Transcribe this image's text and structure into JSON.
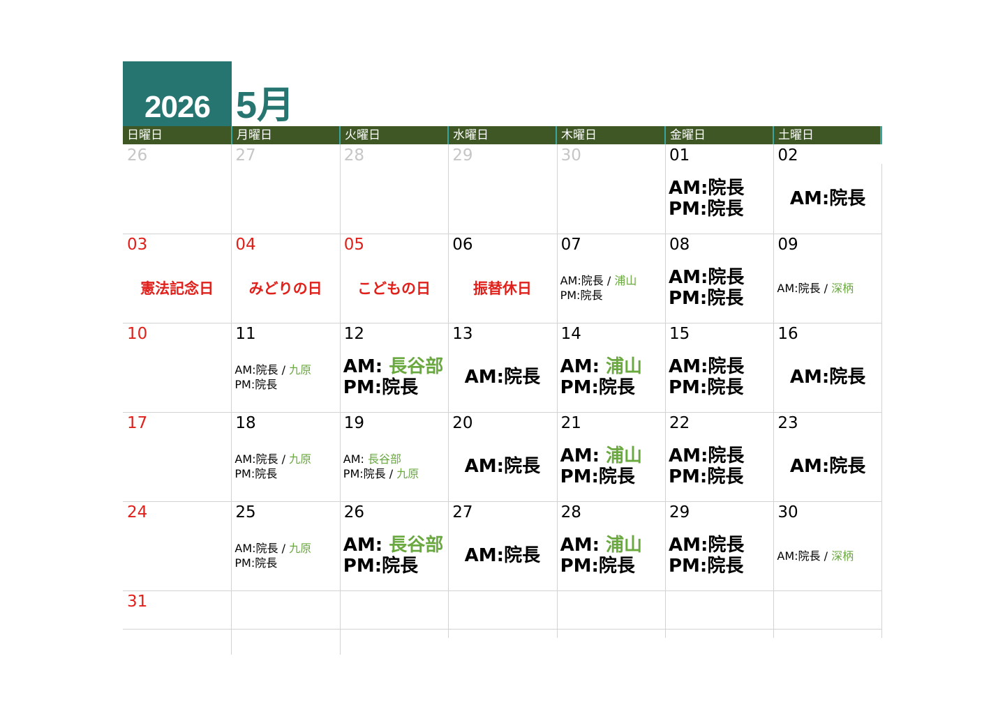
{
  "year": "2026",
  "month": "5月",
  "weekdays": [
    "日曜日",
    "月曜日",
    "火曜日",
    "水曜日",
    "木曜日",
    "金曜日",
    "土曜日"
  ],
  "colors": {
    "teal": "#277570",
    "header_green": "#3f5725",
    "holiday_red": "#e0201b",
    "doctor_green": "#6aa840",
    "muted": "#c6c6c6"
  },
  "weeks": [
    [
      {
        "day": "26",
        "type": "muted"
      },
      {
        "day": "27",
        "type": "muted"
      },
      {
        "day": "28",
        "type": "muted"
      },
      {
        "day": "29",
        "type": "muted"
      },
      {
        "day": "30",
        "type": "muted"
      },
      {
        "day": "01",
        "style": "big",
        "lines": [
          {
            "label": "AM:",
            "name": "院長"
          },
          {
            "label": "PM:",
            "name": "院長"
          }
        ]
      },
      {
        "day": "02",
        "style": "big",
        "align": "center",
        "lines": [
          {
            "label": "AM:",
            "name": "院長"
          }
        ]
      }
    ],
    [
      {
        "day": "03",
        "type": "holiday",
        "holiday": "憲法記念日"
      },
      {
        "day": "04",
        "type": "holiday",
        "holiday": "みどりの日"
      },
      {
        "day": "05",
        "type": "holiday",
        "holiday": "こどもの日"
      },
      {
        "day": "06",
        "holiday": "振替休日"
      },
      {
        "day": "07",
        "style": "small",
        "lines": [
          {
            "label": "AM:",
            "name": "院長",
            "extra": "浦山"
          },
          {
            "label": "PM:",
            "name": "院長"
          }
        ]
      },
      {
        "day": "08",
        "style": "big",
        "lines": [
          {
            "label": "AM:",
            "name": "院長"
          },
          {
            "label": "PM:",
            "name": "院長"
          }
        ]
      },
      {
        "day": "09",
        "style": "small",
        "lines": [
          {
            "label": "AM:",
            "name": "院長",
            "extra": "深柄"
          }
        ]
      }
    ],
    [
      {
        "day": "10",
        "type": "holiday"
      },
      {
        "day": "11",
        "style": "small",
        "lines": [
          {
            "label": "AM:",
            "name": "院長",
            "extra": "九原"
          },
          {
            "label": "PM:",
            "name": "院長"
          }
        ]
      },
      {
        "day": "12",
        "style": "big",
        "lines": [
          {
            "label": "AM: ",
            "green": "長谷部"
          },
          {
            "label": "PM:",
            "name": "院長"
          }
        ]
      },
      {
        "day": "13",
        "style": "big",
        "align": "center",
        "lines": [
          {
            "label": "AM:",
            "name": "院長"
          }
        ]
      },
      {
        "day": "14",
        "style": "big",
        "lines": [
          {
            "label": "AM: ",
            "green": "浦山"
          },
          {
            "label": "PM:",
            "name": "院長"
          }
        ]
      },
      {
        "day": "15",
        "style": "big",
        "lines": [
          {
            "label": "AM:",
            "name": "院長"
          },
          {
            "label": "PM:",
            "name": "院長"
          }
        ]
      },
      {
        "day": "16",
        "style": "big",
        "align": "center",
        "lines": [
          {
            "label": "AM:",
            "name": "院長"
          }
        ]
      }
    ],
    [
      {
        "day": "17",
        "type": "holiday"
      },
      {
        "day": "18",
        "style": "small",
        "lines": [
          {
            "label": "AM:",
            "name": "院長",
            "extra": "九原"
          },
          {
            "label": "PM:",
            "name": "院長"
          }
        ]
      },
      {
        "day": "19",
        "style": "small",
        "lines": [
          {
            "label": "AM: ",
            "green": "長谷部"
          },
          {
            "label": "PM:",
            "name": "院長",
            "extra": "九原"
          }
        ]
      },
      {
        "day": "20",
        "style": "big",
        "align": "center",
        "lines": [
          {
            "label": "AM:",
            "name": "院長"
          }
        ]
      },
      {
        "day": "21",
        "style": "big",
        "lines": [
          {
            "label": "AM: ",
            "green": "浦山"
          },
          {
            "label": "PM:",
            "name": "院長"
          }
        ]
      },
      {
        "day": "22",
        "style": "big",
        "lines": [
          {
            "label": "AM:",
            "name": "院長"
          },
          {
            "label": "PM:",
            "name": "院長"
          }
        ]
      },
      {
        "day": "23",
        "style": "big",
        "align": "center",
        "lines": [
          {
            "label": "AM:",
            "name": "院長"
          }
        ]
      }
    ],
    [
      {
        "day": "24",
        "type": "holiday"
      },
      {
        "day": "25",
        "style": "small",
        "lines": [
          {
            "label": "AM:",
            "name": "院長",
            "extra": "九原"
          },
          {
            "label": "PM:",
            "name": "院長"
          }
        ]
      },
      {
        "day": "26",
        "style": "big",
        "lines": [
          {
            "label": "AM: ",
            "green": "長谷部"
          },
          {
            "label": "PM:",
            "name": "院長"
          }
        ]
      },
      {
        "day": "27",
        "style": "big",
        "align": "center",
        "lines": [
          {
            "label": "AM:",
            "name": "院長"
          }
        ]
      },
      {
        "day": "28",
        "style": "big",
        "lines": [
          {
            "label": "AM: ",
            "green": "浦山"
          },
          {
            "label": "PM:",
            "name": "院長"
          }
        ]
      },
      {
        "day": "29",
        "style": "big",
        "lines": [
          {
            "label": "AM:",
            "name": "院長"
          },
          {
            "label": "PM:",
            "name": "院長"
          }
        ]
      },
      {
        "day": "30",
        "style": "small",
        "lines": [
          {
            "label": "AM:",
            "name": "院長",
            "extra": "深柄"
          }
        ]
      }
    ],
    [
      {
        "day": "31",
        "type": "holiday"
      }
    ]
  ]
}
